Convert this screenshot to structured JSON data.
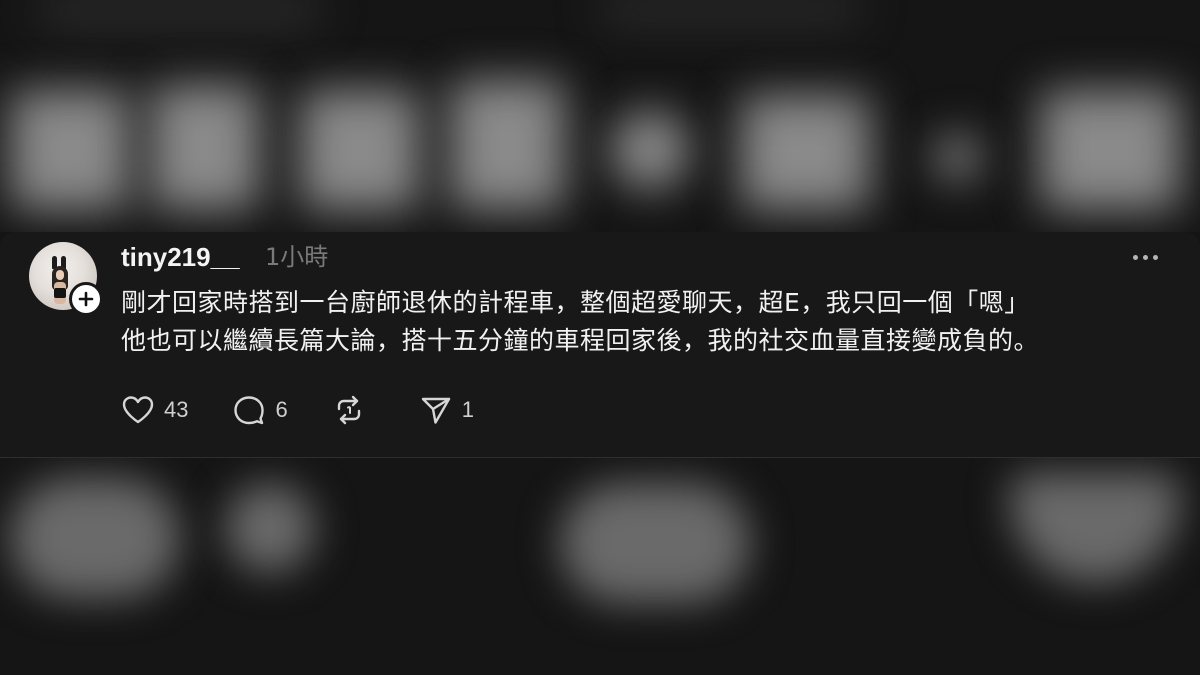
{
  "post": {
    "username": "tiny219__",
    "timestamp": "1小時",
    "text_lines": [
      "剛才回家時搭到一台廚師退休的計程車，整個超愛聊天，超E，我只回一個「嗯」",
      "他也可以繼續長篇大論，搭十五分鐘的車程回家後，我的社交血量直接變成負的。"
    ],
    "actions": {
      "likes": "43",
      "comments": "6",
      "reposts": "",
      "shares": "1"
    }
  },
  "icons": {
    "follow": "plus-icon",
    "more": "more-horizontal-icon",
    "like": "heart-icon",
    "comment": "comment-bubble-icon",
    "repost": "repost-arrows-icon",
    "share": "send-icon"
  },
  "colors": {
    "background": "#181818",
    "text": "#f1f1f1",
    "muted": "#7a7a7a"
  }
}
